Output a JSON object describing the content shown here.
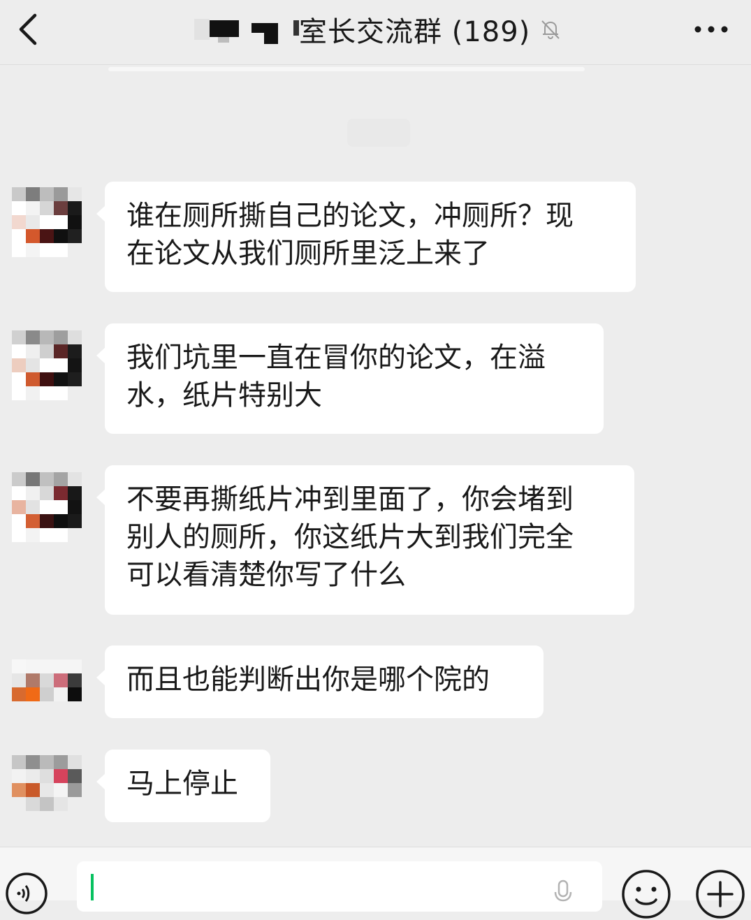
{
  "header": {
    "title": "室长交流群 (189)",
    "back_icon": "chevron-left-icon",
    "mute_icon": "bell-muted-icon",
    "more_icon": "more-dots-icon"
  },
  "messages": [
    {
      "sender_avatar": "pixelated-avatar",
      "text": "谁在厕所撕自己的论文，冲厕所？现\n在论文从我们厕所里泛上来了"
    },
    {
      "sender_avatar": "pixelated-avatar",
      "text": "我们坑里一直在冒你的论文，在溢\n水，纸片特别大"
    },
    {
      "sender_avatar": "pixelated-avatar",
      "text": "不要再撕纸片冲到里面了，你会堵到\n别人的厕所，你这纸片大到我们完全\n可以看清楚你写了什么"
    },
    {
      "sender_avatar": "pixelated-avatar",
      "text": "而且也能判断出你是哪个院的"
    },
    {
      "sender_avatar": "pixelated-avatar",
      "text": "马上停止"
    }
  ],
  "input_bar": {
    "voice_icon": "voice-icon",
    "input_value": "",
    "mic_icon": "mic-icon",
    "emoji_icon": "emoji-icon",
    "plus_icon": "plus-icon"
  },
  "colors": {
    "background": "#ededed",
    "bubble": "#ffffff",
    "text": "#191919",
    "caret": "#07c160"
  }
}
